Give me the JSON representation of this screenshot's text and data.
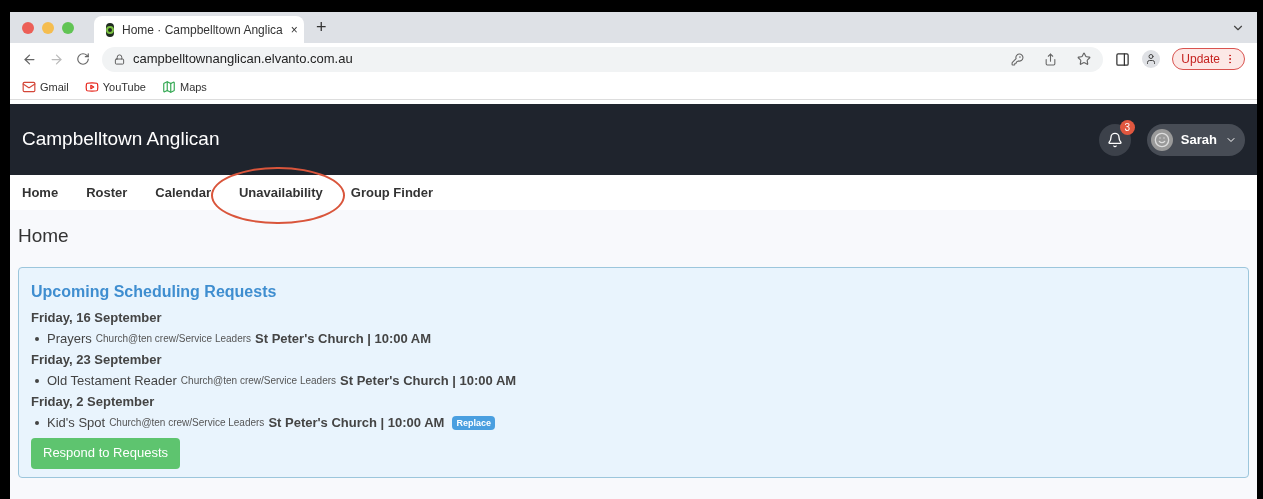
{
  "browser": {
    "tab_title": "Home · Campbelltown Anglica",
    "tab_close": "×",
    "new_tab": "+",
    "url": "campbelltownanglican.elvanto.com.au",
    "update_button": "Update",
    "bookmarks": [
      {
        "label": "Gmail",
        "kind": "gmail"
      },
      {
        "label": "YouTube",
        "kind": "youtube"
      },
      {
        "label": "Maps",
        "kind": "maps"
      }
    ]
  },
  "header": {
    "site_title": "Campbelltown Anglican",
    "notification_count": "3",
    "user_name": "Sarah"
  },
  "nav": [
    {
      "label": "Home",
      "circled": false
    },
    {
      "label": "Roster",
      "circled": false
    },
    {
      "label": "Calendar",
      "circled": false
    },
    {
      "label": "Unavailability",
      "circled": true
    },
    {
      "label": "Group Finder",
      "circled": false
    }
  ],
  "page_title": "Home",
  "requests": {
    "title": "Upcoming Scheduling Requests",
    "groups": [
      {
        "date": "Friday, 16 September",
        "items": [
          {
            "role": "Prayers",
            "team": "Church@ten crew/Service Leaders",
            "place_time": "St Peter's Church | 10:00 AM"
          }
        ]
      },
      {
        "date": "Friday, 23 September",
        "items": [
          {
            "role": "Old Testament Reader",
            "team": "Church@ten crew/Service Leaders",
            "place_time": "St Peter's Church | 10:00 AM"
          }
        ]
      },
      {
        "date": "Friday, 2 September",
        "items": [
          {
            "role": "Kid's Spot",
            "team": "Church@ten crew/Service Leaders",
            "place_time": "St Peter's Church | 10:00 AM",
            "badge": "Replace"
          }
        ]
      }
    ],
    "button": "Respond to Requests"
  }
}
